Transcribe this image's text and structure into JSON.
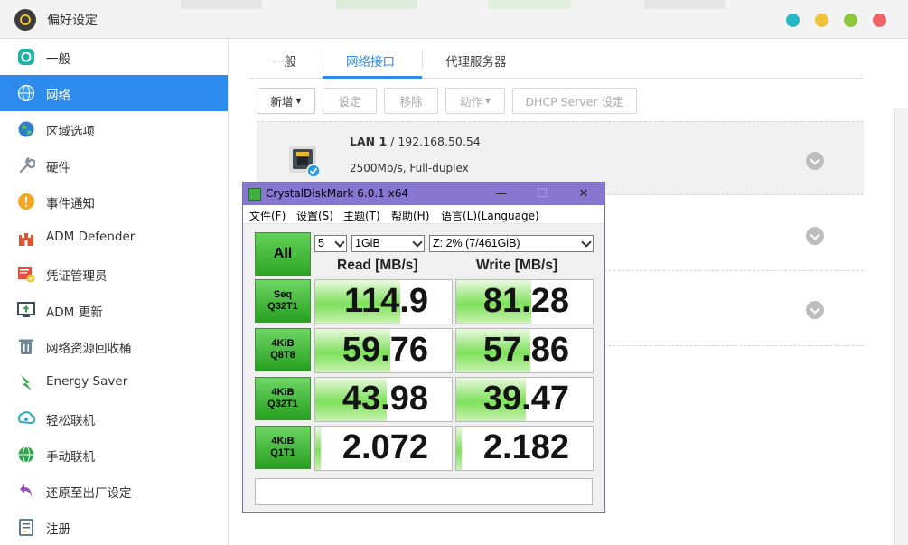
{
  "window": {
    "title": "偏好设定"
  },
  "colors": {
    "accent": "#2d8bed",
    "dot_teal": "#27b6c4",
    "dot_yellow": "#f3c23b",
    "dot_green": "#8cc63f",
    "dot_red": "#f06469",
    "cdm_titlebar": "#8877d0",
    "cdm_green": "#3fb040"
  },
  "sidebar": {
    "items": [
      {
        "label": "一般",
        "icon": "general-icon"
      },
      {
        "label": "网络",
        "icon": "globe-icon",
        "active": true
      },
      {
        "label": "区域选项",
        "icon": "region-icon"
      },
      {
        "label": "硬件",
        "icon": "wrench-icon"
      },
      {
        "label": "事件通知",
        "icon": "alert-icon"
      },
      {
        "label": "ADM Defender",
        "icon": "castle-icon"
      },
      {
        "label": "凭证管理员",
        "icon": "certificate-icon"
      },
      {
        "label": "ADM 更新",
        "icon": "update-icon"
      },
      {
        "label": "网络资源回收桶",
        "icon": "recycle-bin-icon"
      },
      {
        "label": "Energy Saver",
        "icon": "energy-icon"
      },
      {
        "label": "轻松联机",
        "icon": "ezconnect-icon"
      },
      {
        "label": "手动联机",
        "icon": "manual-connect-icon"
      },
      {
        "label": "还原至出厂设定",
        "icon": "restore-icon"
      },
      {
        "label": "注册",
        "icon": "register-icon"
      }
    ]
  },
  "tabs": {
    "general": "一般",
    "network_interface": "网络接口",
    "proxy": "代理服务器"
  },
  "toolbar": {
    "add": "新增",
    "settings": "设定",
    "remove": "移除",
    "action": "动作",
    "dhcp": "DHCP Server 设定"
  },
  "lan": [
    {
      "name": "LAN 1",
      "ip": " / 192.168.50.54",
      "speed": "2500Mb/s, Full-duplex"
    }
  ],
  "cdm": {
    "title": "CrystalDiskMark 6.0.1 x64",
    "menu": {
      "file": "文件(F)",
      "settings": "设置(S)",
      "theme": "主题(T)",
      "help": "帮助(H)",
      "language": "语言(L)(Language)"
    },
    "all_button": "All",
    "count": "5",
    "size": "1GiB",
    "drive": "Z: 2% (7/461GiB)",
    "read_header": "Read [MB/s]",
    "write_header": "Write [MB/s]",
    "rows": [
      {
        "line1": "Seq",
        "line2": "Q32T1",
        "read": "114.9",
        "write": "81.28",
        "read_fill": 0.62,
        "write_fill": 0.55
      },
      {
        "line1": "4KiB",
        "line2": "Q8T8",
        "read": "59.76",
        "write": "57.86",
        "read_fill": 0.55,
        "write_fill": 0.54
      },
      {
        "line1": "4KiB",
        "line2": "Q32T1",
        "read": "43.98",
        "write": "39.47",
        "read_fill": 0.52,
        "write_fill": 0.51
      },
      {
        "line1": "4KiB",
        "line2": "Q1T1",
        "read": "2.072",
        "write": "2.182",
        "read_fill": 0.04,
        "write_fill": 0.04
      }
    ]
  }
}
